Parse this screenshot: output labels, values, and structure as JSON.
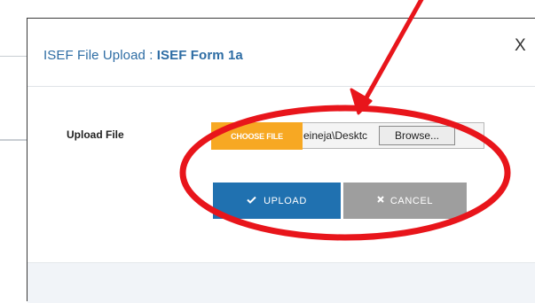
{
  "modal": {
    "title_prefix": "ISEF File Upload : ",
    "title_name": "ISEF Form 1a",
    "close_label": "X"
  },
  "form": {
    "upload_label": "Upload File",
    "choose_file_label": "CHOOSE FILE",
    "file_path_value": "eineja\\Desktc",
    "browse_label": "Browse..."
  },
  "actions": {
    "upload_label": "UPLOAD",
    "upload_icon": "checkmark-icon",
    "cancel_label": "CANCEL",
    "cancel_icon": "x-icon"
  },
  "annotation": {
    "color": "#e8151b",
    "shapes": [
      "red-arrow",
      "red-ellipse"
    ]
  },
  "colors": {
    "title": "#2e6da4",
    "choose_file": "#f7a823",
    "upload_button": "#2071b0",
    "cancel_button": "#9e9e9e"
  }
}
